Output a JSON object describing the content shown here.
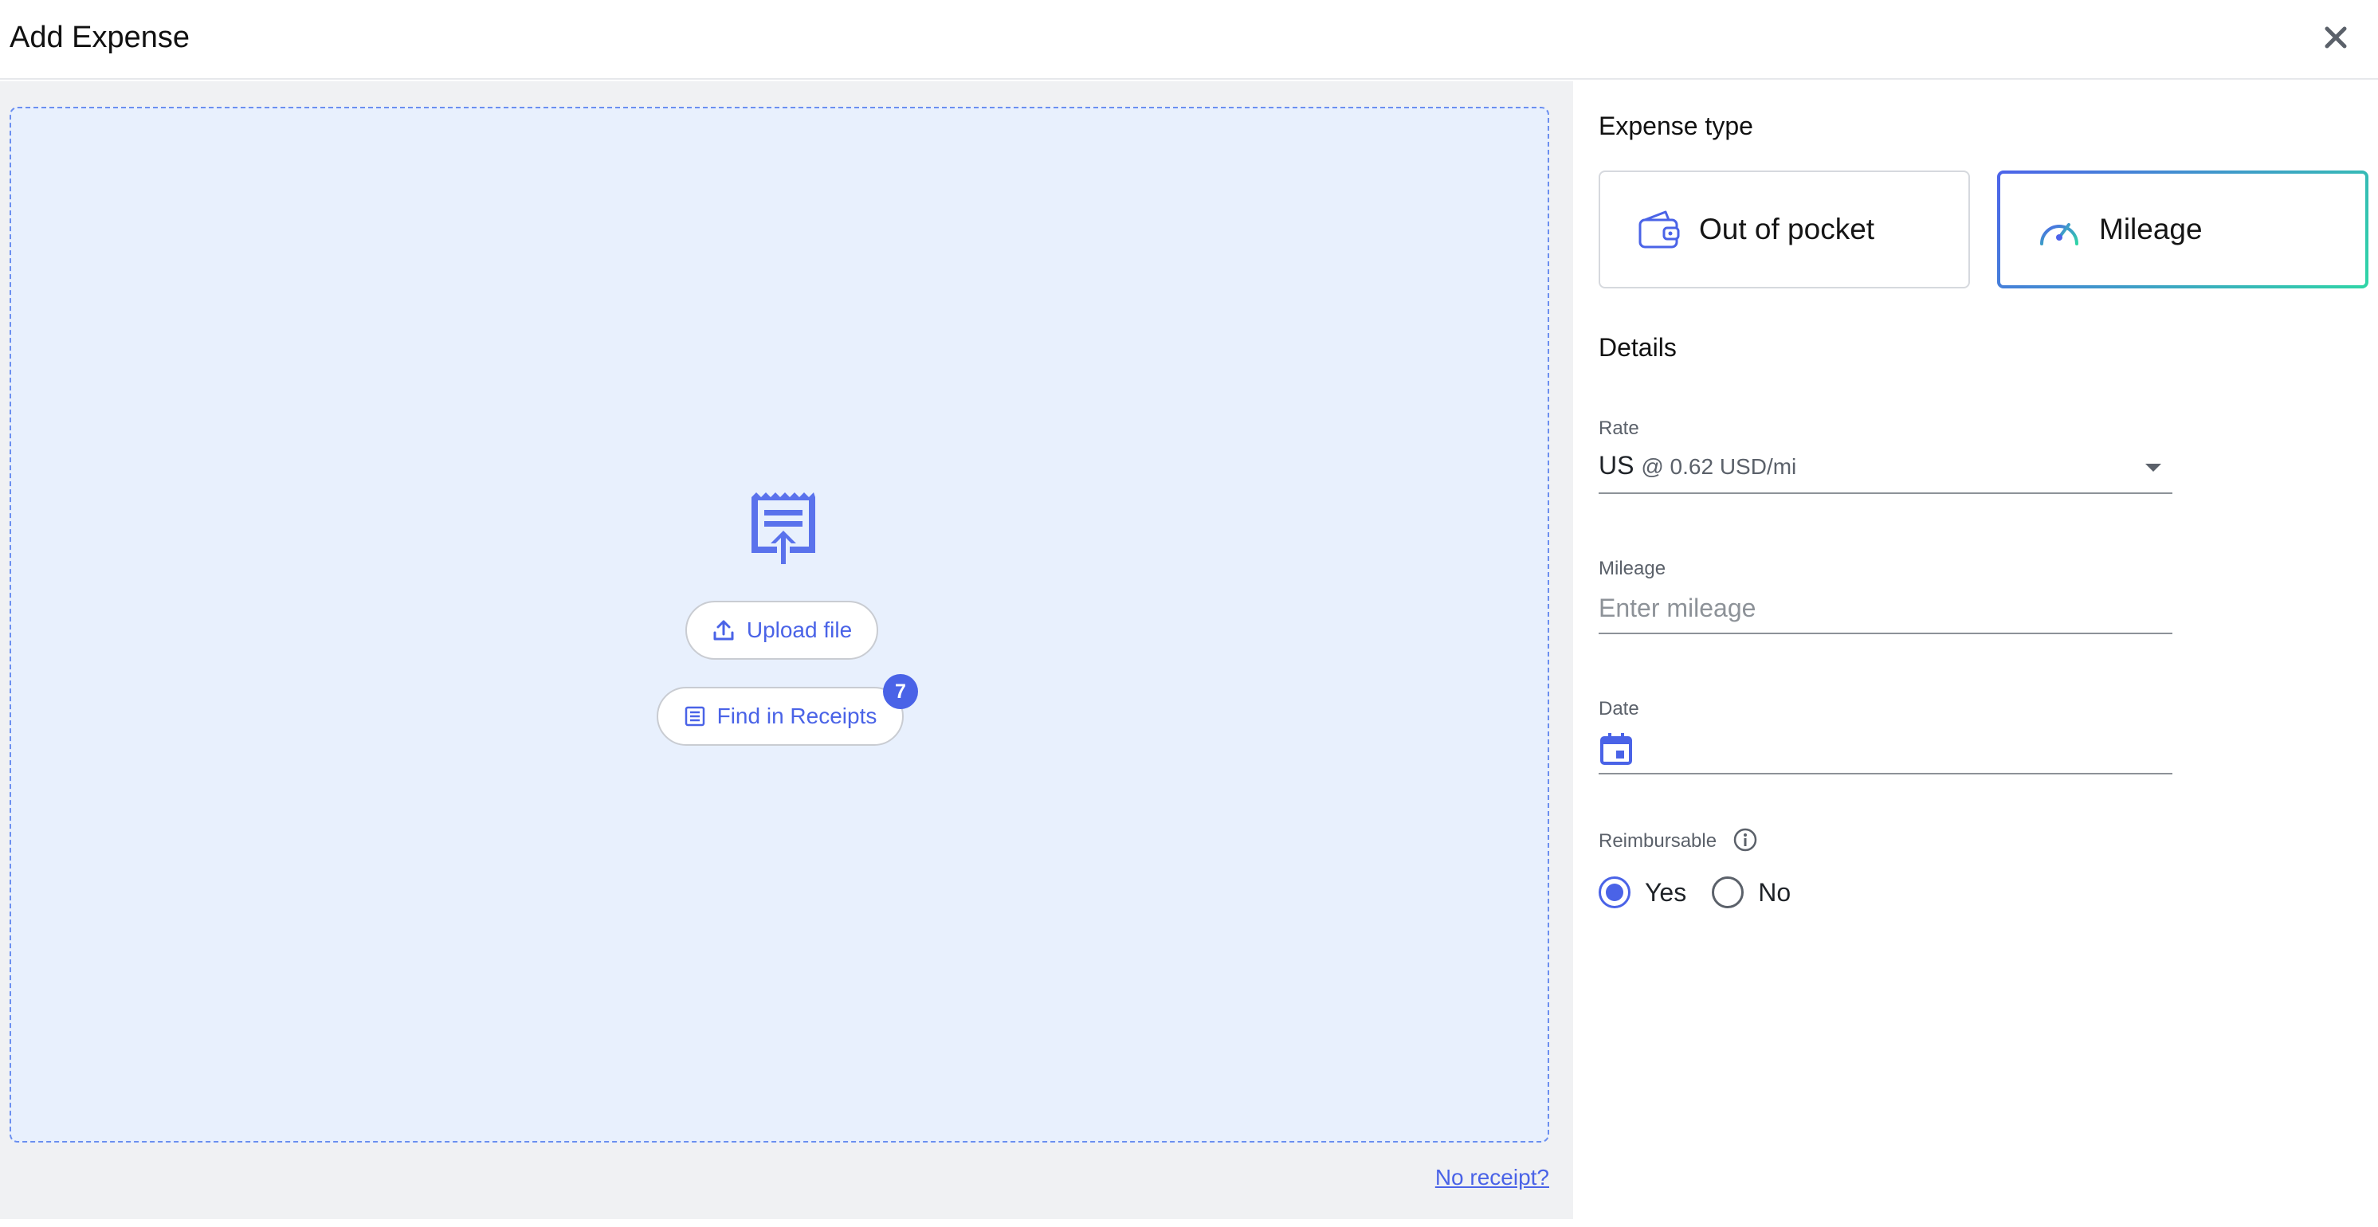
{
  "header": {
    "title": "Add Expense"
  },
  "upload": {
    "upload_label": "Upload file",
    "find_label": "Find in Receipts",
    "find_badge_count": "7",
    "no_receipt_link": "No receipt?"
  },
  "expense_type": {
    "title": "Expense type",
    "options": [
      {
        "label": "Out of pocket",
        "icon": "wallet-icon",
        "selected": false
      },
      {
        "label": "Mileage",
        "icon": "speedometer-icon",
        "selected": true
      }
    ]
  },
  "details": {
    "title": "Details",
    "rate": {
      "label": "Rate",
      "value": "US",
      "sub": "@ 0.62 USD/mi"
    },
    "mileage": {
      "label": "Mileage",
      "placeholder": "Enter mileage",
      "value": ""
    },
    "date": {
      "label": "Date",
      "value": ""
    },
    "reimbursable": {
      "label": "Reimbursable",
      "options": [
        {
          "label": "Yes",
          "selected": true
        },
        {
          "label": "No",
          "selected": false
        }
      ]
    }
  },
  "colors": {
    "accent": "#4a63e7",
    "accent_gradient_end": "#2fd6a6",
    "dropzone_bg": "#e8f0fd",
    "left_pane_bg": "#f0f1f3"
  }
}
